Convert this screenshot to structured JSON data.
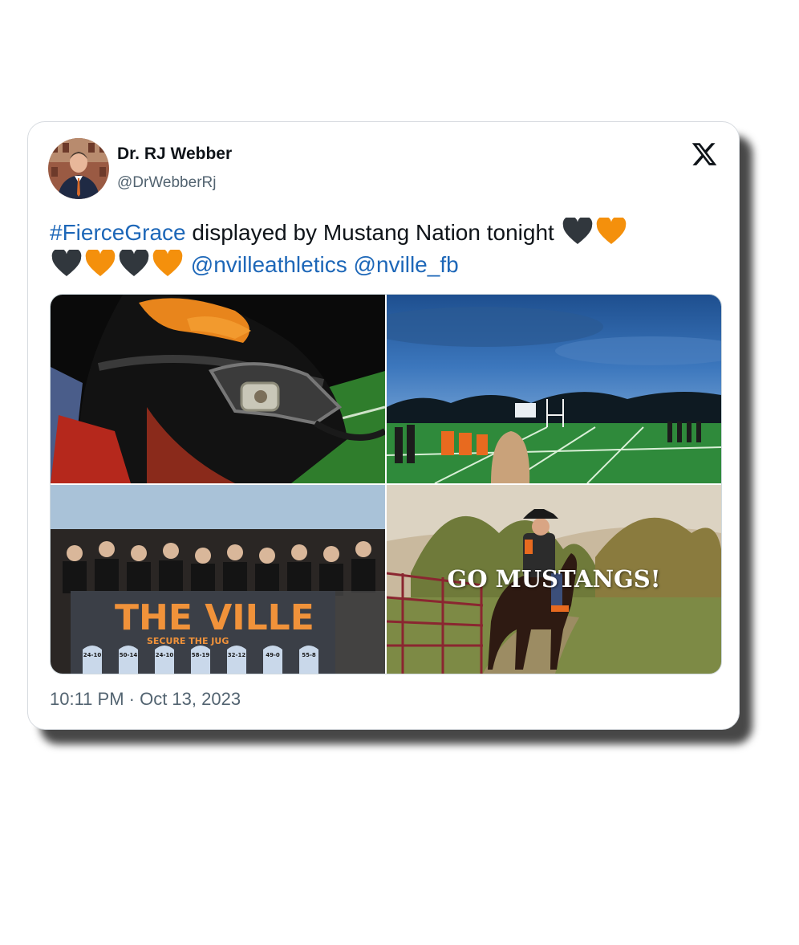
{
  "author": {
    "name": "Dr. RJ Webber",
    "handle": "@DrWebberRj"
  },
  "tweet": {
    "hashtag": "#FierceGrace",
    "text": " displayed by Mustang Nation tonight ",
    "hearts_line1": [
      "black",
      "orange"
    ],
    "hearts_line2": [
      "black",
      "orange",
      "black",
      "orange"
    ],
    "mention1": "@nvilleathletics",
    "mention2": "@nville_fb"
  },
  "media": {
    "overlay_text": "GO MUSTANGS!",
    "banner_title": "THE VILLE",
    "banner_subtitle": "SECURE THE JUG",
    "banner_scores": [
      "24-10",
      "50-14",
      "24-10",
      "58-19",
      "32-12",
      "49-0",
      "55-8"
    ]
  },
  "timestamp": "10:11 PM · Oct 13, 2023",
  "icons": {
    "brand": "x-logo-icon",
    "heart_black": "black-heart-icon",
    "heart_orange": "orange-heart-icon"
  },
  "colors": {
    "link": "#1d67b8",
    "heart_black": "#31373d",
    "heart_orange": "#f4900c",
    "muted_text": "#536471"
  }
}
